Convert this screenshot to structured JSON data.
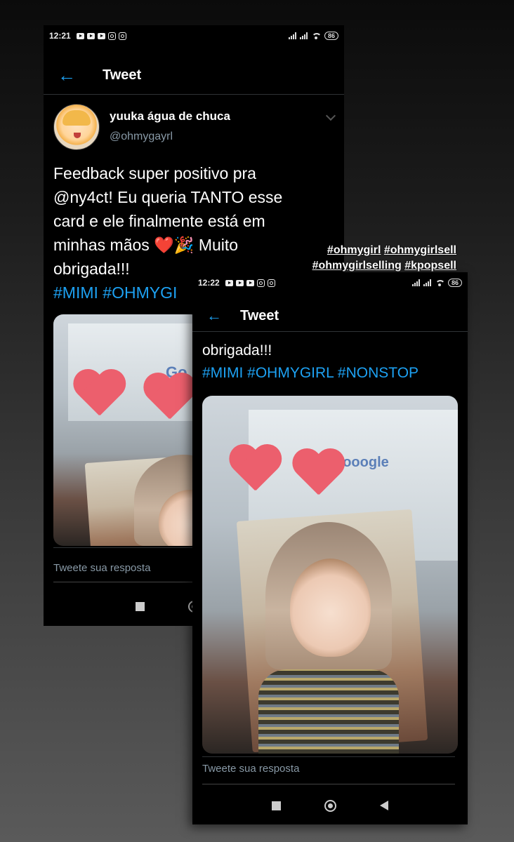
{
  "shot1": {
    "status": {
      "time": "12:21",
      "battery": "86"
    },
    "header": {
      "title": "Tweet"
    },
    "author": {
      "display_name": "yuuka água de chuca",
      "handle": "@ohmygayrl"
    },
    "tweet": {
      "line1": "Feedback super positivo pra",
      "line2": "@ny4ct! Eu queria TANTO esse",
      "line3": "card e ele finalmente está em",
      "line4_pre": "minhas mãos",
      "line4_emoji_heart": "❤️",
      "line4_emoji_party": "🎉",
      "line4_post": "Muito",
      "line5": "obrigada!!!",
      "hashtags": "#MIMI #OHMYGI"
    },
    "reply_placeholder": "Tweete sua resposta"
  },
  "shot2": {
    "status": {
      "time": "12:22",
      "battery": "86"
    },
    "header": {
      "title": "Tweet"
    },
    "tweet": {
      "line1": "obrigada!!!",
      "hashtags": "#MIMI #OHMYGIRL #NONSTOP"
    },
    "reply_placeholder": "Tweete sua resposta"
  },
  "overlay_tags": [
    "#ohmygirl",
    "#ohmygirlsell",
    "#ohmygirlselling",
    "#kpopsell"
  ],
  "colors": {
    "link": "#1da1f2",
    "background": "#000000",
    "heart": "#e0245e"
  }
}
